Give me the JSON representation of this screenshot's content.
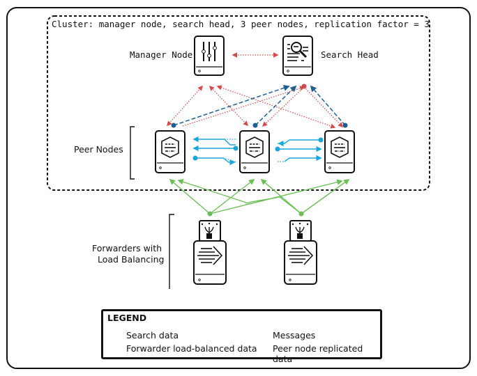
{
  "cluster": {
    "caption": "Cluster: manager node, search head, 3 peer nodes, replication factor = 3"
  },
  "nodes": {
    "manager": {
      "label": "Manager Node",
      "icon": "sliders-icon"
    },
    "search_head": {
      "label": "Search Head",
      "icon": "magnifier-document-icon"
    },
    "peer_group_label": "Peer Nodes",
    "peers": [
      {
        "icon": "hexagon-server-icon"
      },
      {
        "icon": "hexagon-server-icon"
      },
      {
        "icon": "hexagon-server-icon"
      }
    ],
    "forwarder_group_label_line1": "Forwarders with",
    "forwarder_group_label_line2": "Load Balancing",
    "forwarders": [
      {
        "icon": "forwarder-arrow-icon"
      },
      {
        "icon": "forwarder-arrow-icon"
      }
    ]
  },
  "legend": {
    "title": "LEGEND",
    "items": [
      {
        "label": "Search data",
        "color": "#1f5f95",
        "style": "dashed"
      },
      {
        "label": "Messages",
        "color": "#d24a4a",
        "style": "dotted"
      },
      {
        "label": "Forwarder load-balanced data",
        "color": "#6cbf58",
        "style": "solid"
      },
      {
        "label": "Peer node replicated data",
        "color": "#1aa6dc",
        "style": "solid"
      }
    ]
  },
  "colors": {
    "search": "#1f5f95",
    "messages": "#d24a4a",
    "forwarder": "#6cbf58",
    "replication": "#1aa6dc",
    "outline": "#111111"
  }
}
